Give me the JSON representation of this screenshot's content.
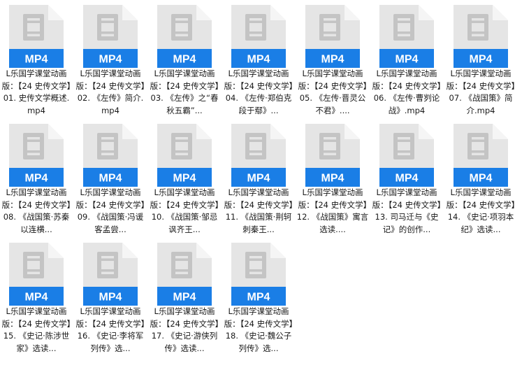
{
  "colors": {
    "page_bg": "#ffffff",
    "doc_body": "#e5e5e5",
    "doc_fold": "#f5f5f5",
    "doc_glyph": "#c4c4c4",
    "badge_bg": "#1a7ee6",
    "badge_text": "#ffffff",
    "label_text": "#1a1a1a"
  },
  "icon": {
    "name": "video-file-icon",
    "badge_label": "MP4"
  },
  "files": [
    {
      "name": "L乐国学课堂动画版：【24 史传文学】01. 史传文学概述.mp4"
    },
    {
      "name": "L乐国学课堂动画版：【24 史传文学】02. 《左传》简介.mp4"
    },
    {
      "name": "L乐国学课堂动画版：【24 史传文学】03. 《左传》之“春秋五霸”..."
    },
    {
      "name": "L乐国学课堂动画版：【24 史传文学】04. 《左传·郑伯克段于鄢》..."
    },
    {
      "name": "L乐国学课堂动画版：【24 史传文学】05. 《左传·晋灵公不君》...."
    },
    {
      "name": "L乐国学课堂动画版：【24 史传文学】06. 《左传·曹刿论战》.mp4"
    },
    {
      "name": "L乐国学课堂动画版：【24 史传文学】07. 《战国策》简介.mp4"
    },
    {
      "name": "L乐国学课堂动画版：【24 史传文学】08. 《战国策·苏秦以连横..."
    },
    {
      "name": "L乐国学课堂动画版：【24 史传文学】09. 《战国策·冯谖客孟尝..."
    },
    {
      "name": "L乐国学课堂动画版：【24 史传文学】10. 《战国策·邹忌讽齐王..."
    },
    {
      "name": "L乐国学课堂动画版：【24 史传文学】11. 《战国策·荆轲刺秦王..."
    },
    {
      "name": "L乐国学课堂动画版：【24 史传文学】12. 《战国策》寓言选读...."
    },
    {
      "name": "L乐国学课堂动画版：【24 史传文学】13. 司马迁与《史记》的创作..."
    },
    {
      "name": "L乐国学课堂动画版：【24 史传文学】14. 《史记·项羽本纪》选读..."
    },
    {
      "name": "L乐国学课堂动画版：【24 史传文学】15. 《史记·陈涉世家》选读..."
    },
    {
      "name": "L乐国学课堂动画版：【24 史传文学】16. 《史记·李将军列传》选..."
    },
    {
      "name": "L乐国学课堂动画版：【24 史传文学】17. 《史记·游侠列传》选读..."
    },
    {
      "name": "L乐国学课堂动画版：【24 史传文学】18. 《史记·魏公子列传》选..."
    }
  ]
}
